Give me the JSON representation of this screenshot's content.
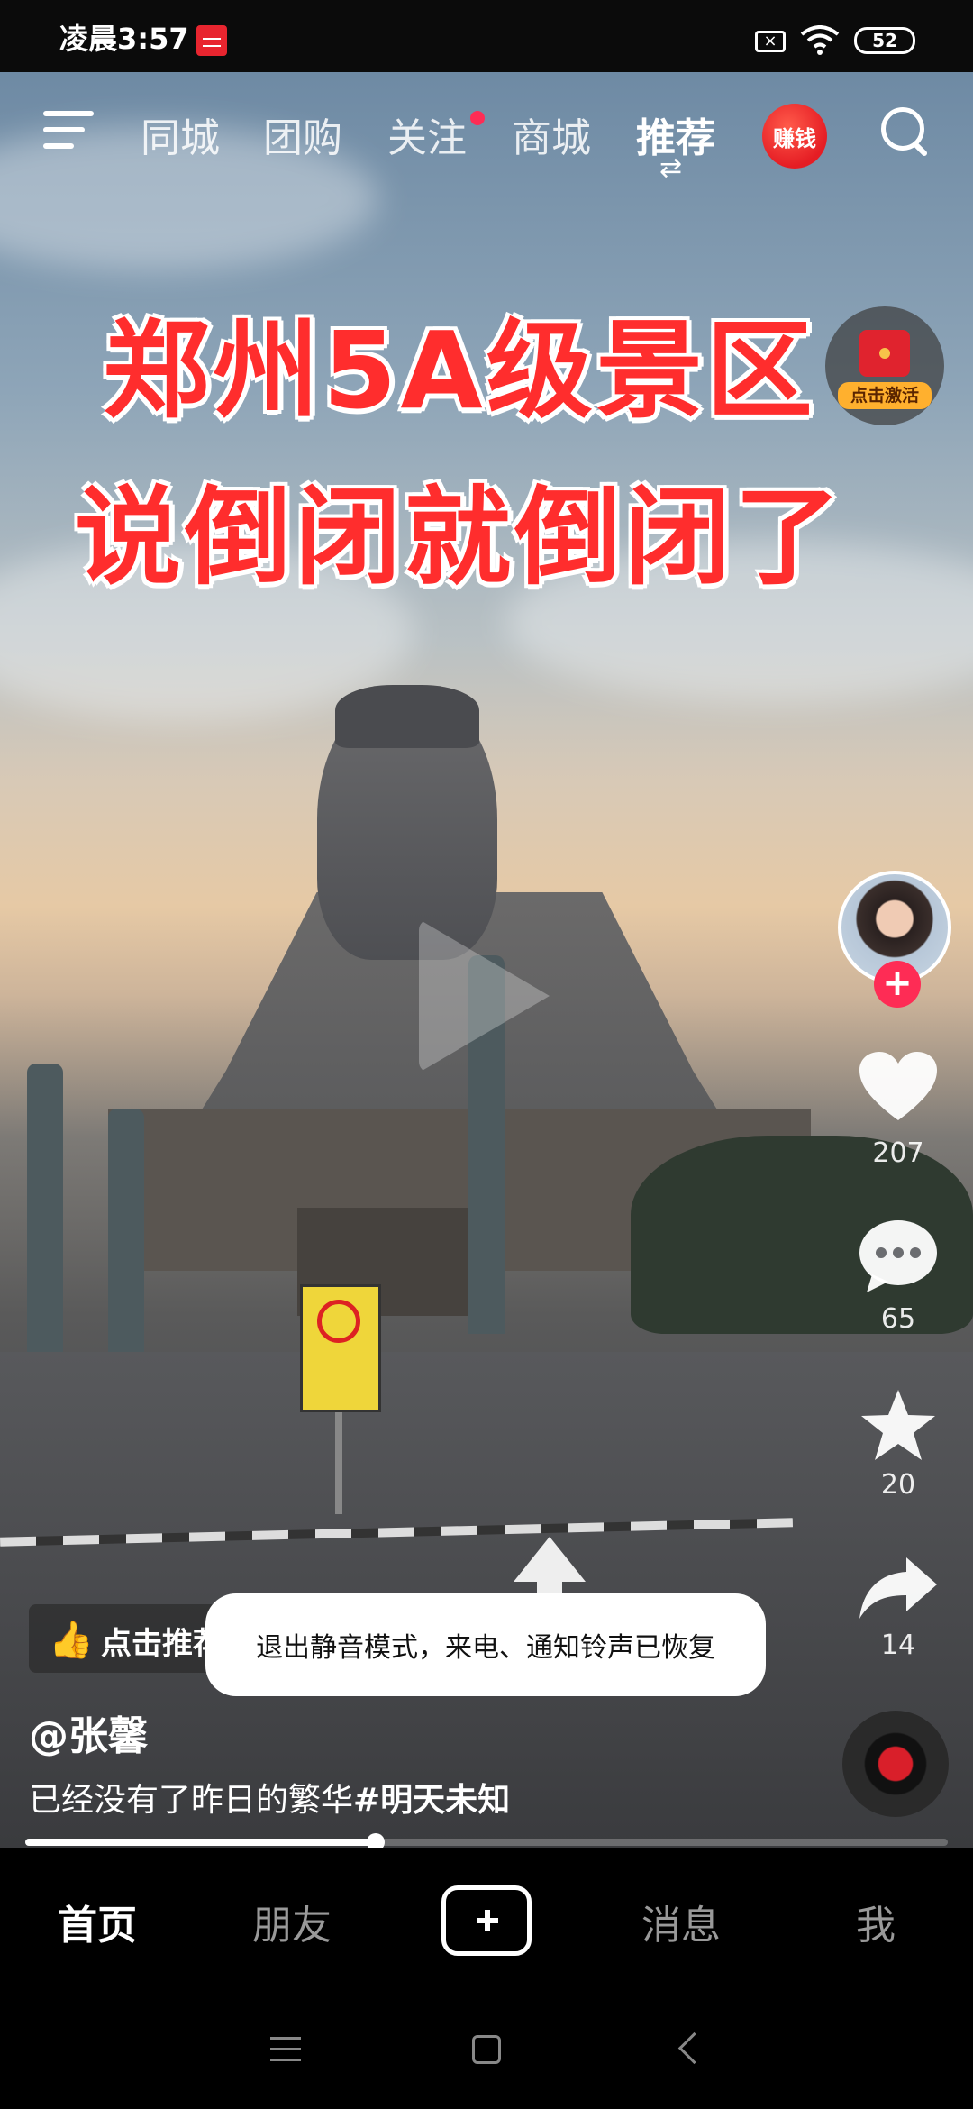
{
  "status_bar": {
    "time": "凌晨3:57",
    "battery": "52"
  },
  "top_nav": {
    "tabs": [
      "同城",
      "团购",
      "关注",
      "商城",
      "推荐"
    ],
    "active_tab": "推荐",
    "earn_label": "赚钱"
  },
  "video": {
    "headline_line1": "郑州5A级景区",
    "headline_line2": "说倒闭就倒闭了",
    "redpacket_label": "点击激活",
    "recommend_label": "点击推荐",
    "author": "@张馨",
    "caption_text": "已经没有了昨日的繁华",
    "caption_hashtag": "#明天未知",
    "progress": 0.38
  },
  "actions": {
    "likes": "207",
    "comments": "65",
    "favorites": "20",
    "shares": "14"
  },
  "toast": {
    "message": "退出静音模式，来电、通知铃声已恢复"
  },
  "bottom_tabs": {
    "home": "首页",
    "friends": "朋友",
    "messages": "消息",
    "me": "我"
  },
  "colors": {
    "accent": "#fe2c55",
    "headline": "#ff2d2d"
  }
}
